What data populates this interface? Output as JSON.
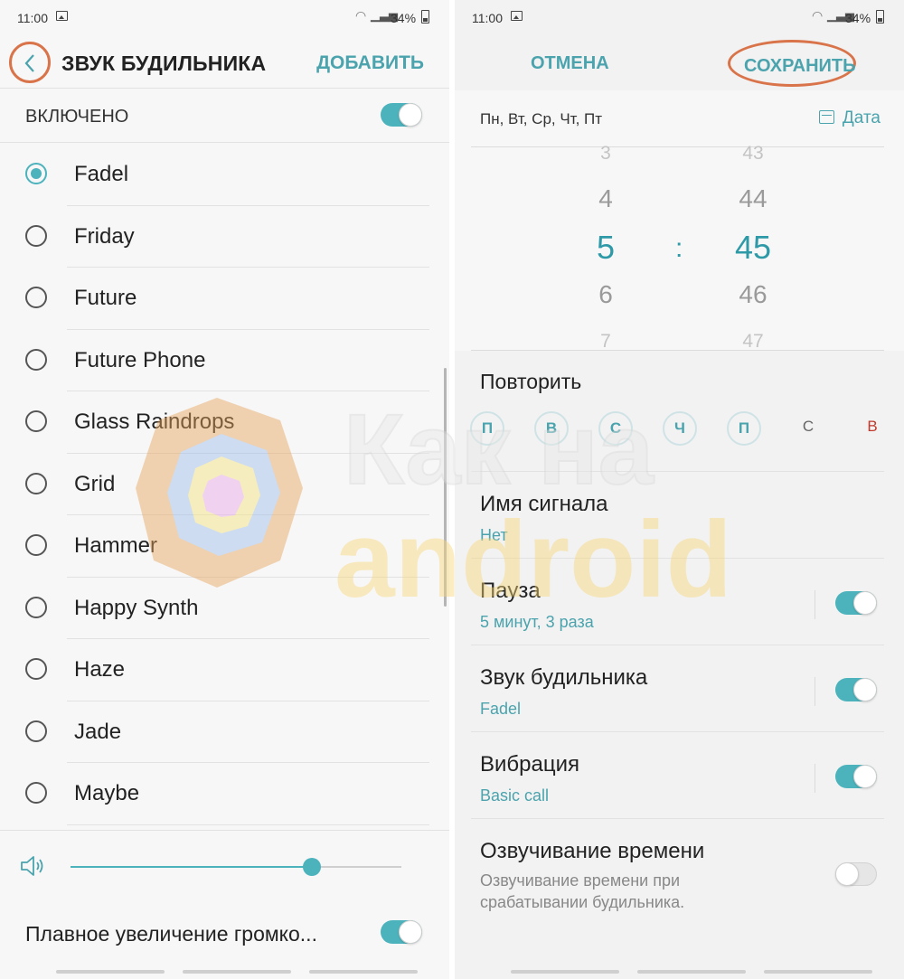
{
  "left": {
    "status": {
      "time": "11:00",
      "battery": "34%"
    },
    "header": {
      "title": "ЗВУК БУДИЛЬНИКА",
      "add_label": "ДОБАВИТЬ"
    },
    "enabled": {
      "label": "ВКЛЮЧЕНО",
      "on": true
    },
    "sounds": [
      {
        "name": "Fadel",
        "selected": true
      },
      {
        "name": "Friday",
        "selected": false
      },
      {
        "name": "Future",
        "selected": false
      },
      {
        "name": "Future Phone",
        "selected": false
      },
      {
        "name": "Glass Raindrops",
        "selected": false
      },
      {
        "name": "Grid",
        "selected": false
      },
      {
        "name": "Hammer",
        "selected": false
      },
      {
        "name": "Happy Synth",
        "selected": false
      },
      {
        "name": "Haze",
        "selected": false
      },
      {
        "name": "Jade",
        "selected": false
      },
      {
        "name": "Maybe",
        "selected": false
      }
    ],
    "volume": {
      "level": 0.73
    },
    "gradual": {
      "label": "Плавное увеличение громко...",
      "on": true
    }
  },
  "right": {
    "status": {
      "time": "11:00",
      "battery": "34%"
    },
    "header": {
      "cancel_label": "ОТМЕНА",
      "save_label": "СОХРАНИТЬ"
    },
    "days_summary": "Пн, Вт, Ср, Чт, Пт",
    "date_label": "Дата",
    "picker": {
      "hours": [
        "3",
        "4",
        "5",
        "6",
        "7"
      ],
      "minutes": [
        "43",
        "44",
        "45",
        "46",
        "47"
      ],
      "separator": ":"
    },
    "repeat": {
      "label": "Повторить",
      "days": [
        {
          "label": "П",
          "active": true
        },
        {
          "label": "В",
          "active": true
        },
        {
          "label": "С",
          "active": true
        },
        {
          "label": "Ч",
          "active": true
        },
        {
          "label": "П",
          "active": true
        },
        {
          "label": "С",
          "active": false
        },
        {
          "label": "В",
          "active": false
        }
      ]
    },
    "settings": {
      "name": {
        "title": "Имя сигнала",
        "value": "Нет"
      },
      "snooze": {
        "title": "Пауза",
        "value": "5 минут, 3 раза",
        "on": true
      },
      "sound": {
        "title": "Звук будильника",
        "value": "Fadel",
        "on": true
      },
      "vibration": {
        "title": "Вибрация",
        "value": "Basic call",
        "on": true
      },
      "voice": {
        "title": "Озвучивание времени",
        "value": "Озвучивание времени при срабатывании будильника.",
        "on": false
      }
    }
  },
  "colors": {
    "accent": "#4cb3bd",
    "accent_text": "#4aa3ad",
    "highlight_ring": "#d9744a",
    "sunday": "#c0392b"
  },
  "watermark": {
    "line1": "Как на",
    "line2": "android"
  }
}
